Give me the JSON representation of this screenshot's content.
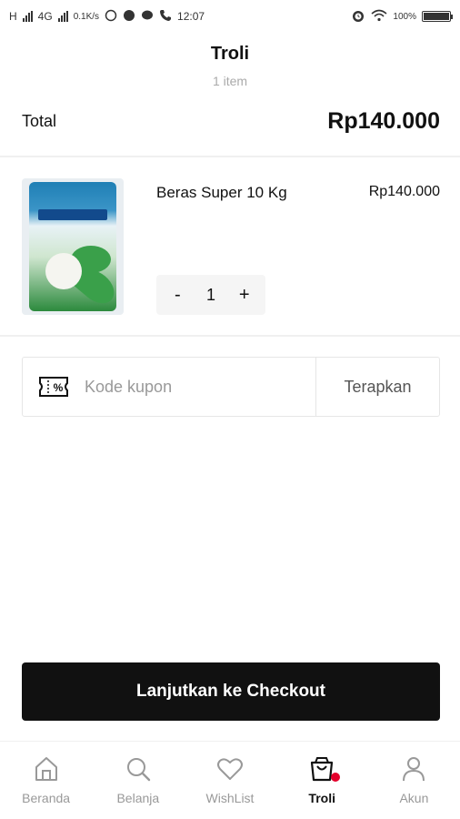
{
  "status_bar": {
    "left_text": "H",
    "network": "4G",
    "speed": "0.1K/s",
    "time": "12:07",
    "battery": "100%"
  },
  "header": {
    "title": "Troli",
    "item_count": "1 item"
  },
  "summary": {
    "total_label": "Total",
    "total_value": "Rp140.000"
  },
  "cart": {
    "items": [
      {
        "name": "Beras Super 10 Kg",
        "price": "Rp140.000",
        "quantity": "1",
        "decrement": "-",
        "increment": "+"
      }
    ]
  },
  "coupon": {
    "icon": "coupon-icon",
    "placeholder": "Kode kupon",
    "value": "",
    "apply_label": "Terapkan"
  },
  "checkout": {
    "label": "Lanjutkan ke Checkout"
  },
  "bottom_nav": {
    "items": [
      {
        "label": "Beranda",
        "icon": "home-icon"
      },
      {
        "label": "Belanja",
        "icon": "search-icon"
      },
      {
        "label": "WishList",
        "icon": "heart-icon"
      },
      {
        "label": "Troli",
        "icon": "shopping-bag-icon",
        "active": true
      },
      {
        "label": "Akun",
        "icon": "user-icon"
      }
    ]
  },
  "colors": {
    "primary": "#111111",
    "badge": "#e4002b",
    "muted": "#999999"
  }
}
